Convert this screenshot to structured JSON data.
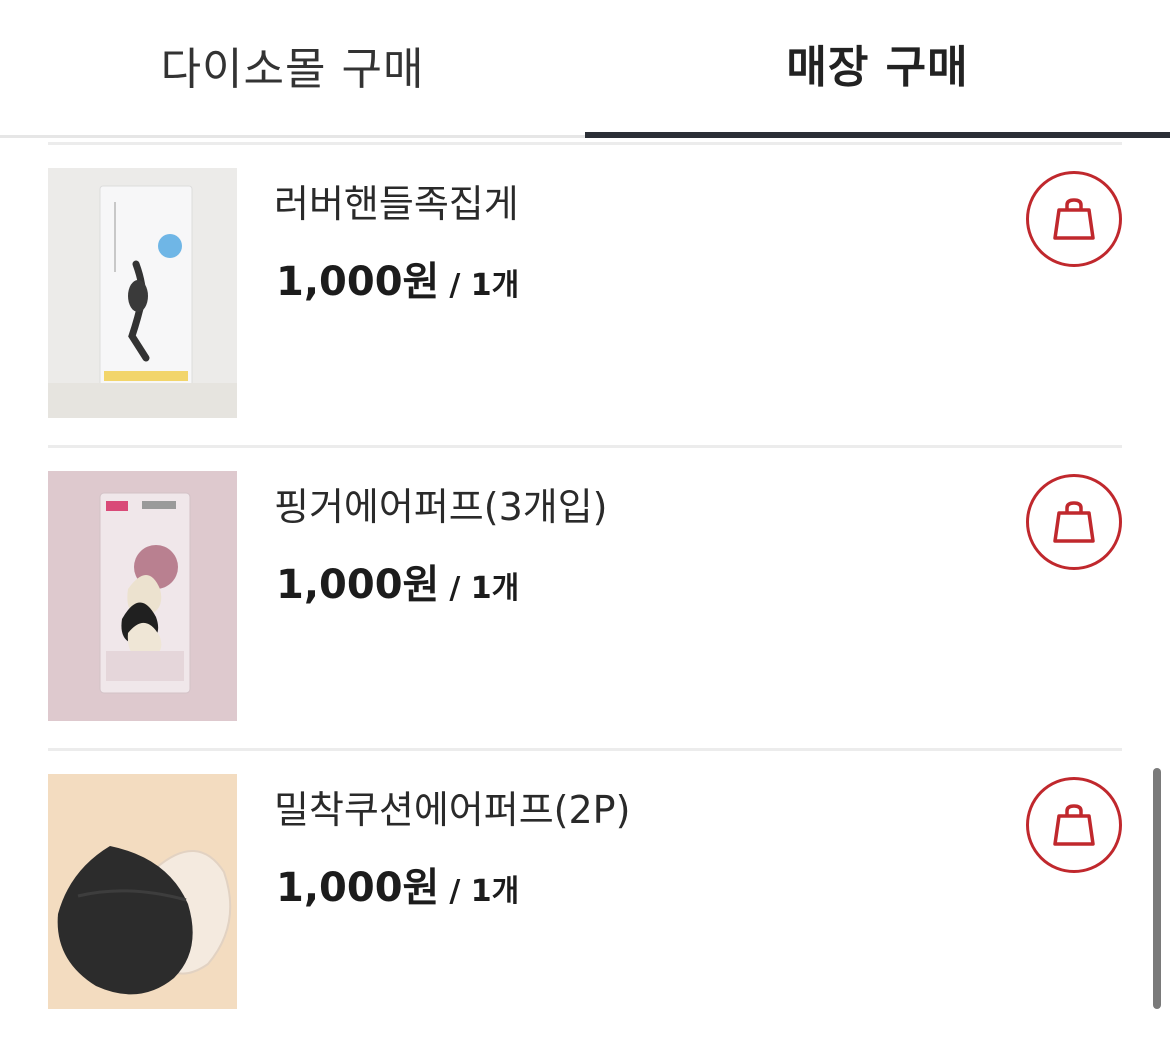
{
  "tabs": [
    {
      "label": "다이소몰 구매",
      "active": false
    },
    {
      "label": "매장 구매",
      "active": true
    }
  ],
  "products": [
    {
      "name": "러버핸들족집게",
      "price": "1,000원",
      "unit": "/ 1개",
      "image": "rubber-handle-tweezers-photo"
    },
    {
      "name": "핑거에어퍼프(3개입)",
      "price": "1,000원",
      "unit": "/ 1개",
      "image": "finger-air-puff-package-photo"
    },
    {
      "name": "밀착쿠션에어퍼프(2P)",
      "price": "1,000원",
      "unit": "/ 1개",
      "image": "cushion-air-puff-photo"
    }
  ],
  "icons": {
    "cart": "shopping-bag-icon"
  },
  "colors": {
    "accent": "#c0282d",
    "active_tab_underline": "#2b2f36"
  }
}
